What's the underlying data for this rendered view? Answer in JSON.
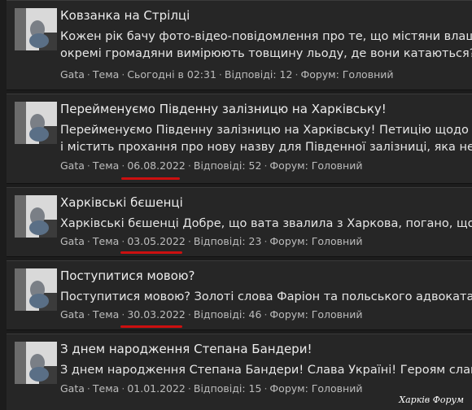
{
  "posts": [
    {
      "title": "Ковзанка на Стрілці",
      "excerpt_lines": [
        "Кожен рік бачу фото-відео-повідомлення про те, що містяни влаштовую",
        "окремі громадяни вимірюють товщину льоду, де вони катаються? Одна с"
      ],
      "author": "Gata",
      "type": "Тема",
      "date": "Сьогодні в 02:31",
      "replies": "Відповіді: 12",
      "forum": "Форум: Головний"
    },
    {
      "title": "Перейменуємо Південну залізницю на Харківську!",
      "excerpt_lines": [
        "Перейменуємо Південну залізницю на Харківську! Петицію щодо дерусі",
        "і містить прохання про нову назву для Південної залізниці, яка не може т"
      ],
      "author": "Gata",
      "type": "Тема",
      "date": "06.08.2022",
      "replies": "Відповіді: 52",
      "forum": "Форум: Головний"
    },
    {
      "title": "Харківські бєшенці",
      "excerpt_lines": [
        "Харківські бєшенці Добре, що вата звалила з Харкова, погано, що вона п"
      ],
      "author": "Gata",
      "type": "Тема",
      "date": "03.05.2022",
      "replies": "Відповіді: 23",
      "forum": "Форум: Головний"
    },
    {
      "title": "Поступитися мовою?",
      "excerpt_lines": [
        "Поступитися мовою? Золоті слова Фаріон та польського адвоката Пшеми"
      ],
      "author": "Gata",
      "type": "Тема",
      "date": "30.03.2022",
      "replies": "Відповіді: 46",
      "forum": "Форум: Головний"
    },
    {
      "title": "З днем народження Степана Бандери!",
      "excerpt_lines": [
        "З днем народження Степана Бандери! Слава Україні! Героям слава!"
      ],
      "author": "Gata",
      "type": "Тема",
      "date": "01.01.2022",
      "replies": "Відповіді: 15",
      "forum": "Форум: Головний"
    }
  ],
  "watermark": "Харків Форум",
  "colors": {
    "underline": "#cc1010",
    "background": "#262626"
  }
}
